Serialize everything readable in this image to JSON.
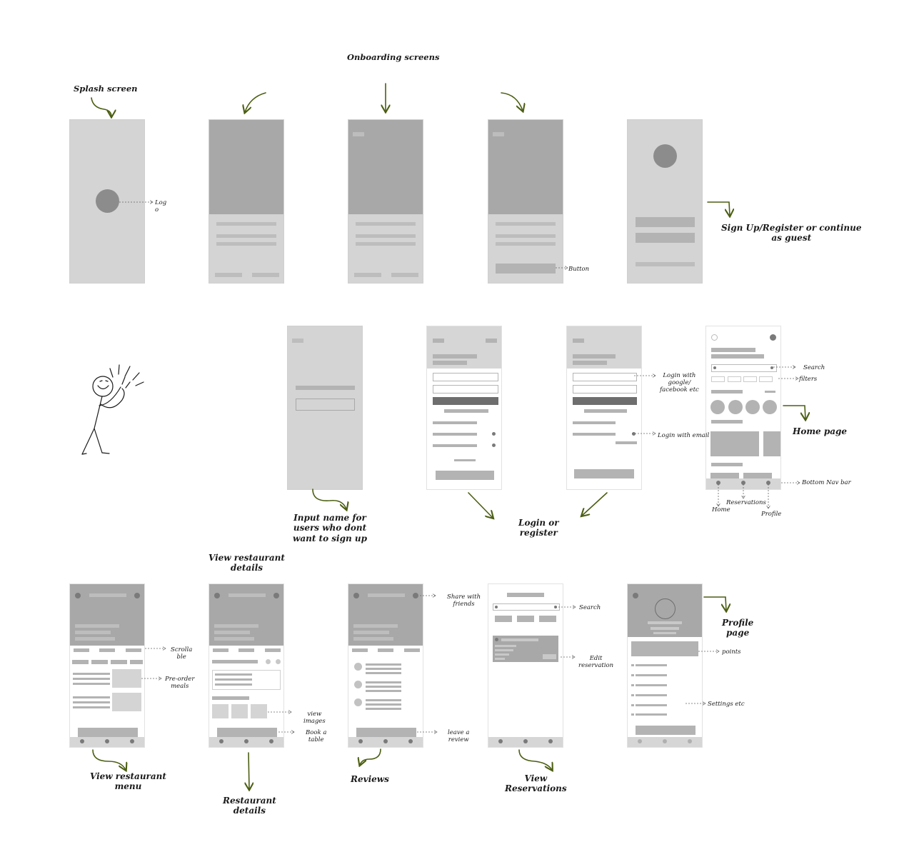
{
  "annotations": {
    "splash": "Splash screen",
    "onboarding": "Onboarding screens",
    "logo": "Log\no",
    "button": "Button",
    "signup": "Sign Up/Register or continue\nas guest",
    "input_name": "Input name for\nusers who dont\nwant to sign up",
    "login_register": "Login or\nregister",
    "login_google": "Login with\ngoogle/\nfacebook etc",
    "login_email": "Login with email",
    "search": "Search",
    "filters": "filters",
    "home_page": "Home page",
    "bottom_nav": "Bottom Nav bar",
    "nav_home": "Home",
    "nav_reservations": "Reservations",
    "nav_profile": "Profile",
    "view_restaurant_details": "View restaurant\ndetails",
    "scrollable": "Scrolla\nble",
    "pre_order": "Pre-order\nmeals",
    "view_images": "view\nimages",
    "book_table": "Book a\ntable",
    "share": "Share with\nfriends",
    "leave_review": "leave a\nreview",
    "search2": "Search",
    "edit_reservation": "Edit\nreservation",
    "profile_page": "Profile\npage",
    "points": "points",
    "settings": "Settings etc",
    "view_menu": "View restaurant\nmenu",
    "restaurant_details": "Restaurant\ndetails",
    "reviews": "Reviews",
    "view_reservations": "View\nReservations"
  },
  "colors": {
    "arrow": "#4b5e12",
    "screen_bg": "#d4d4d4",
    "block_dark": "#a8a8a8"
  }
}
